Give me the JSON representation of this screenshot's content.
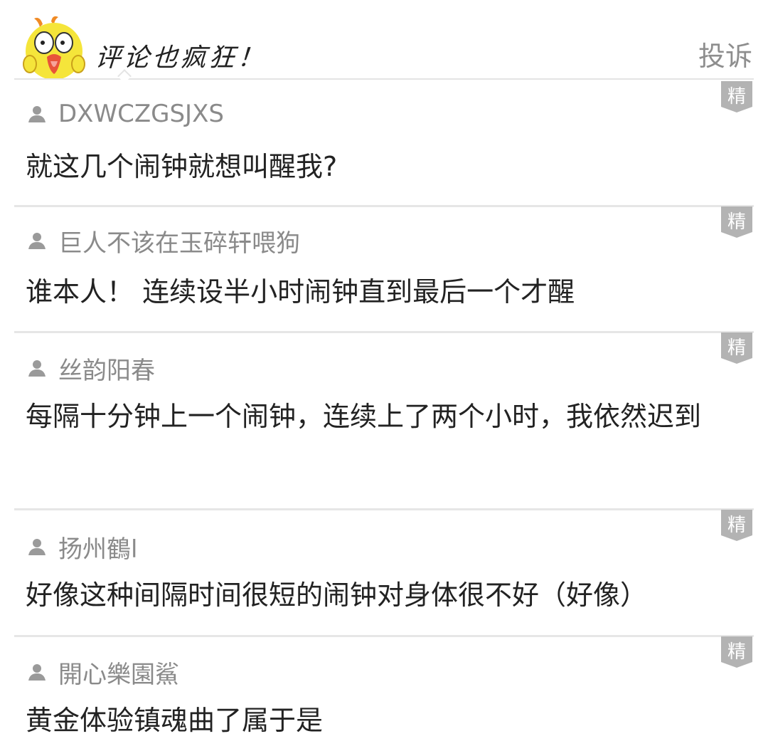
{
  "header": {
    "title": "评论也疯狂！",
    "report_label": "投诉",
    "mascot_icon": "yellow-bird-mascot-icon"
  },
  "badge_label": "精",
  "comments": [
    {
      "user": "DXWCZGSJXS",
      "text": "就这几个闹钟就想叫醒我?"
    },
    {
      "user": "巨人不该在玉碎轩喂狗",
      "text": "谁本人！ 连续设半小时闹钟直到最后一个才醒"
    },
    {
      "user": "丝韵阳春",
      "text": "每隔十分钟上一个闹钟，连续上了两个小时，我依然迟到"
    },
    {
      "user": "扬州鶴l",
      "text": "好像这种间隔时间很短的闹钟对身体很不好（好像）"
    },
    {
      "user": "開心樂園鯊",
      "text": "黄金体验镇魂曲了属于是"
    }
  ],
  "colors": {
    "divider": "#e6e6e6",
    "username": "#8a8a8a",
    "text": "#222222",
    "badge": "#b3b3b3",
    "mascot": "#f5e53a"
  }
}
